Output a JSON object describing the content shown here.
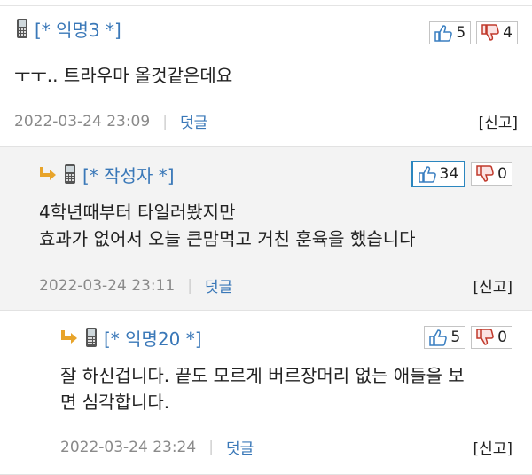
{
  "comments": [
    {
      "author": "[* 익명3 *]",
      "upvotes": "5",
      "downvotes": "4",
      "lines": [
        "ㅜㅜ.. 트라우마 올것같은데요"
      ],
      "date": "2022-03-24 23:09",
      "separator": "|",
      "reply_label": "덧글",
      "report_label": "[신고]"
    },
    {
      "author": "[* 작성자 *]",
      "upvotes": "34",
      "downvotes": "0",
      "lines": [
        "4학년때부터 타일러봤지만",
        "효과가 없어서 오늘 큰맘먹고 거친 훈육을 했습니다"
      ],
      "date": "2022-03-24 23:11",
      "separator": "|",
      "reply_label": "덧글",
      "report_label": "[신고]"
    },
    {
      "author": "[* 익명20 *]",
      "upvotes": "5",
      "downvotes": "0",
      "lines": [
        "잘 하신겁니다. 끝도 모르게 버르장머리 없는 애들을 보",
        "면 심각합니다."
      ],
      "date": "2022-03-24 23:24",
      "separator": "|",
      "reply_label": "덧글",
      "report_label": "[신고]"
    }
  ],
  "colors": {
    "author_link": "#3a78b8",
    "reply_arrow": "#e8a42a",
    "thumb_up": "#3a7fc1",
    "thumb_down": "#c0392b",
    "selected_vote_border": "#2b86bf",
    "reply_background": "#f3f3f3"
  },
  "icons": [
    "phone-icon",
    "reply-arrow-icon",
    "thumbs-up-icon",
    "thumbs-down-icon"
  ]
}
